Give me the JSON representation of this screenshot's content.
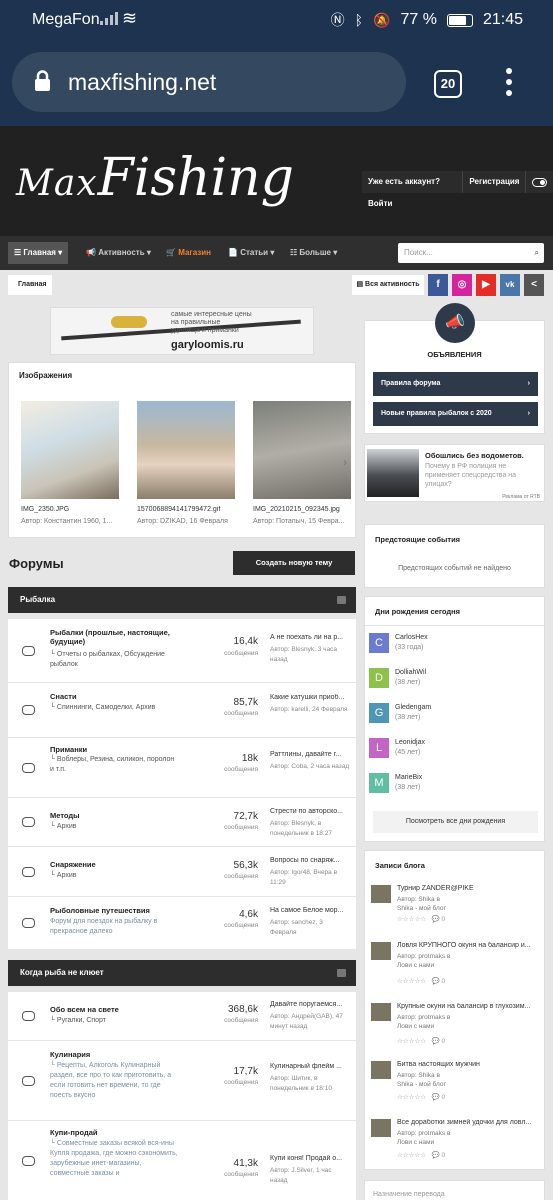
{
  "status": {
    "carrier": "MegaFon",
    "battery": "77 %",
    "time": "21:45"
  },
  "browser": {
    "url": "maxfishing.net",
    "tabs": "20"
  },
  "header": {
    "logo_a": "Max",
    "logo_b": "Fishing",
    "login": "Уже есть аккаунт? Войти",
    "register": "Регистрация"
  },
  "nav": {
    "home": "Главная",
    "activity": "Активность",
    "shop": "Магазин",
    "articles": "Статьи",
    "more": "Больше",
    "search_placeholder": "Поиск..."
  },
  "crumbs": {
    "home": "Главная",
    "all_activity": "Вся активность"
  },
  "social": [
    "f",
    "◎",
    "▶",
    "vk",
    "<"
  ],
  "ad": {
    "line1": "самые интересные цены",
    "line2": "на правильные",
    "line3": "удилища и приманки",
    "domain": "garyloomis.ru"
  },
  "images": {
    "title": "Изображения",
    "items": [
      {
        "name": "IMG_2350.JPG",
        "author": "Автор: Константин 1960, 1..."
      },
      {
        "name": "1570068894141799472.gif",
        "author": "Автор: DZIKAD, 16 Февраля"
      },
      {
        "name": "IMG_20210215_092345.jpg",
        "author": "Автор: Потапыч, 15 Февра..."
      }
    ]
  },
  "forums": {
    "title": "Форумы",
    "new_topic": "Создать новую тему",
    "cat1": "Рыбалка",
    "cat2": "Когда рыба не клюет",
    "rows1": [
      {
        "name": "Рыбалки (прошлые, настоящие, будущие)",
        "sub": "└ Отчеты о рыбалках, Обсуждение рыбалок",
        "count": "16,4k",
        "label": "сообщения",
        "lt": "А не поехать ли на р...",
        "lm": "Автор: Blesnyk, 3 часа назад"
      },
      {
        "name": "Снасти",
        "sub": "└ Спиннинги, Самоделки, Архив",
        "count": "85,7k",
        "label": "сообщения",
        "lt": "Какие катушки приоб...",
        "lm": "Автор: karelli, 24 Февраля"
      },
      {
        "name": "Приманки",
        "sub": "└ Воблеры, Резина, силикон, поролон и т.п.",
        "count": "18k",
        "label": "сообщения",
        "lt": "Раттлины, давайте г...",
        "lm": "Автор: Coba, 2 часа назад"
      },
      {
        "name": "Методы",
        "sub": "└ Архив",
        "count": "72,7k",
        "label": "сообщения",
        "lt": "Стрести по авторско...",
        "lm": "Автор: Blesnyk, в понедельник в 18:27"
      },
      {
        "name": "Снаряжение",
        "sub": "└ Архив",
        "count": "56,3k",
        "label": "сообщения",
        "lt": "Вопросы по снаряж...",
        "lm": "Автор: Igor48, Вчера в 11:29"
      },
      {
        "name": "Рыболовные путешествия",
        "sub": "Форум для поездок на рыбалку в прекрасное далеко",
        "count": "4,6k",
        "label": "сообщения",
        "lt": "На самое Белое мор...",
        "lm": "Автор: sanchez, 3 Февраля"
      }
    ],
    "rows2": [
      {
        "name": "Обо всем на свете",
        "sub": "└ Ругалки, Спорт",
        "count": "368,6k",
        "label": "сообщения",
        "lt": "Давайте поругаемся...",
        "lm": "Автор: Андрей(GAB), 47 минут назад"
      },
      {
        "name": "Кулинария",
        "sub": "└ Рецепты, Алкоголь Кулинарный раздел, все про то как приготовить, а если готовить нет времени, то где поесть вкусно",
        "count": "17,7k",
        "label": "сообщения",
        "lt": "Кулинарный флейм ...",
        "lm": "Автор: Шитик, в понедельник в 18:10"
      },
      {
        "name": "Купи-продай",
        "sub": "└ Совместные заказы всякой вся-ины Купля продажа, где можно сэкономить, зарубежные инет-магазины, совместные заказы и",
        "count": "41,3k",
        "label": "сообщения",
        "lt": "Купи коня! Продай о...",
        "lm": "Автор: J.Silver, 1 час назад"
      }
    ]
  },
  "sidebar": {
    "announce_title": "ОБЪЯВЛЕНИЯ",
    "rules": "Правила форума",
    "new_rules": "Новые правила рыбалок с 2020",
    "news_title": "Обошлись без водометов.",
    "news_text": "Почему в РФ полиция не применяет спецсредства на улицах?",
    "news_badge": "Реклама от RTB",
    "events_title": "Предстоящие события",
    "events_empty": "Предстоящих событий не найдено",
    "bday_title": "Дни рождения сегодня",
    "bdays": [
      {
        "letter": "C",
        "name": "CarlosHex",
        "age": "(33 года)",
        "color": "#6b7bd0"
      },
      {
        "letter": "D",
        "name": "DolliahWil",
        "age": "(38 лет)",
        "color": "#8dc24a"
      },
      {
        "letter": "G",
        "name": "Gledengam",
        "age": "(38 лет)",
        "color": "#4f95b5"
      },
      {
        "letter": "L",
        "name": "Leonidjax",
        "age": "(45 лет)",
        "color": "#c464c4"
      },
      {
        "letter": "M",
        "name": "MarieBix",
        "age": "(38 лет)",
        "color": "#5fbfa0"
      }
    ],
    "bday_all": "Посмотреть все дни рождения",
    "blog_title": "Записи блога",
    "blogs": [
      {
        "title": "Турнир ZANDER@PIKE",
        "meta1": "Автор: Shika в",
        "meta2": "Shika - мой блог",
        "c": "0"
      },
      {
        "title": "Ловля КРУПНОГО окуня на балансир и...",
        "meta1": "Автор: protmaks в",
        "meta2": "Лови с нами",
        "c": "0"
      },
      {
        "title": "Крупные окуни на балансир в глухозим...",
        "meta1": "Автор: protmaks в",
        "meta2": "Лови с нами",
        "c": "0"
      },
      {
        "title": "Битва настоящих мужчин",
        "meta1": "Автор: Shika в",
        "meta2": "Shika - мой блог",
        "c": "0"
      },
      {
        "title": "Все доработки зимней удочки для ловл...",
        "meta1": "Автор: protmaks в",
        "meta2": "Лови с нами",
        "c": "0"
      }
    ],
    "next_title": "Назначение перевода"
  }
}
